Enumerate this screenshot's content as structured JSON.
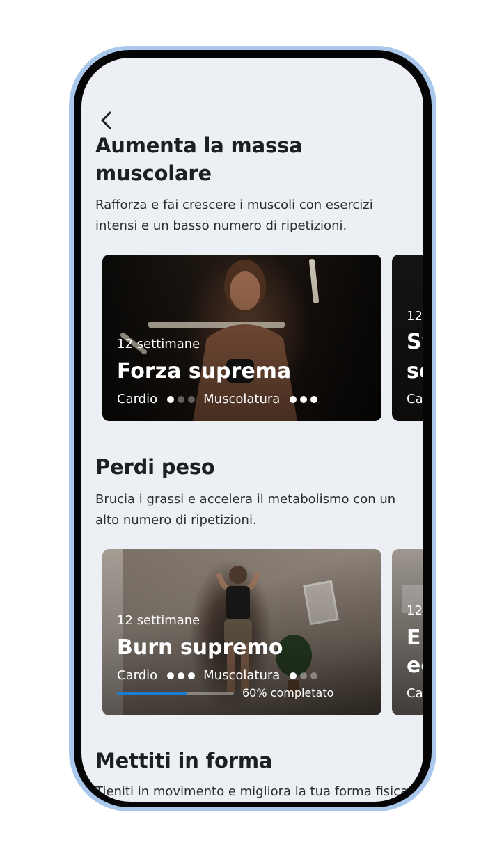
{
  "header": {
    "back_icon": "chevron-left-icon"
  },
  "sections": [
    {
      "title": "Aumenta la massa muscolare",
      "description": "Rafforza e fai crescere i muscoli con esercizi intensi e un basso numero di ripetizioni.",
      "cards": [
        {
          "weeks": "12 settimane",
          "title": "Forza suprema",
          "cardio_label": "Cardio",
          "cardio_level": 1,
          "muscle_label": "Muscolatura",
          "muscle_level": 3
        },
        {
          "weeks": "12",
          "title_line1": "Sv",
          "title_line2": "se",
          "meta": "Ca"
        }
      ]
    },
    {
      "title": "Perdi peso",
      "description": "Brucia i grassi e accelera il metabolismo con un alto numero di ripetizioni.",
      "cards": [
        {
          "weeks": "12 settimane",
          "title": "Burn supremo",
          "cardio_label": "Cardio",
          "cardio_level": 3,
          "muscle_label": "Muscolatura",
          "muscle_level": 1,
          "progress": 0.6,
          "progress_label": "60% completato"
        },
        {
          "weeks": "12",
          "title_line1": "El",
          "title_line2": "ec",
          "meta": "Ca"
        }
      ]
    },
    {
      "title": "Mettiti in forma",
      "description": "Tieniti in movimento e migliora la tua forma fisica"
    }
  ],
  "colors": {
    "frame": "#a9c8eb",
    "screen_bg": "#eceff3",
    "progress": "#1f7bd1",
    "text": "#1d1f22"
  }
}
